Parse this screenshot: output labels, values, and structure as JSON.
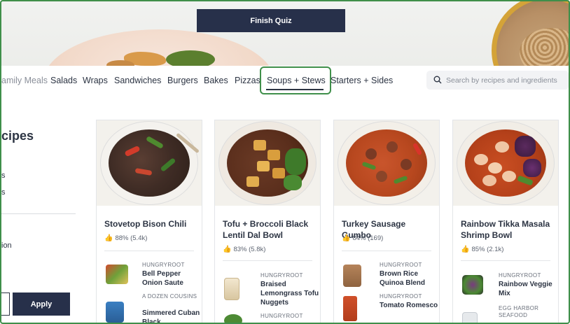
{
  "hero": {
    "finish_quiz_label": "Finish Quiz"
  },
  "nav": {
    "items": [
      {
        "label": "amily Meals"
      },
      {
        "label": "Salads"
      },
      {
        "label": "Wraps"
      },
      {
        "label": "Sandwiches"
      },
      {
        "label": "Burgers"
      },
      {
        "label": "Bakes"
      },
      {
        "label": "Pizzas"
      },
      {
        "label": "Soups + Stews"
      },
      {
        "label": "Starters + Sides"
      }
    ],
    "active": "Soups + Stews"
  },
  "search": {
    "placeholder": "Search by recipes and ingredients",
    "value": ""
  },
  "filters": {
    "title": "cipes",
    "snippets": [
      "s",
      "s",
      "ion"
    ],
    "apply_label": "Apply"
  },
  "cards": [
    {
      "title": "Stovetop Bison Chili",
      "rating": "88% (5.4k)",
      "ingredients": [
        {
          "brand": "HUNGRYROOT",
          "name": "Bell Pepper Onion Saute"
        },
        {
          "brand": "A DOZEN COUSINS",
          "name": "Simmered Cuban Black"
        }
      ]
    },
    {
      "title": "Tofu + Broccoli Black Lentil Dal Bowl",
      "rating": "83% (5.8k)",
      "ingredients": [
        {
          "brand": "HUNGRYROOT",
          "name": "Braised Lemongrass Tofu Nuggets"
        },
        {
          "brand": "HUNGRYROOT",
          "name": ""
        }
      ]
    },
    {
      "title": "Turkey Sausage Gumbo",
      "rating": "84% (169)",
      "ingredients": [
        {
          "brand": "HUNGRYROOT",
          "name": "Brown Rice Quinoa Blend"
        },
        {
          "brand": "HUNGRYROOT",
          "name": "Tomato Romesco"
        }
      ]
    },
    {
      "title": "Rainbow Tikka Masala Shrimp Bowl",
      "rating": "85% (2.1k)",
      "ingredients": [
        {
          "brand": "HUNGRYROOT",
          "name": "Rainbow Veggie Mix"
        },
        {
          "brand": "EGG HARBOR SEAFOOD",
          "name": ""
        }
      ]
    }
  ],
  "colors": {
    "navy": "#27304a",
    "highlight_green": "#3f8f4a",
    "text": "#2c3443"
  }
}
